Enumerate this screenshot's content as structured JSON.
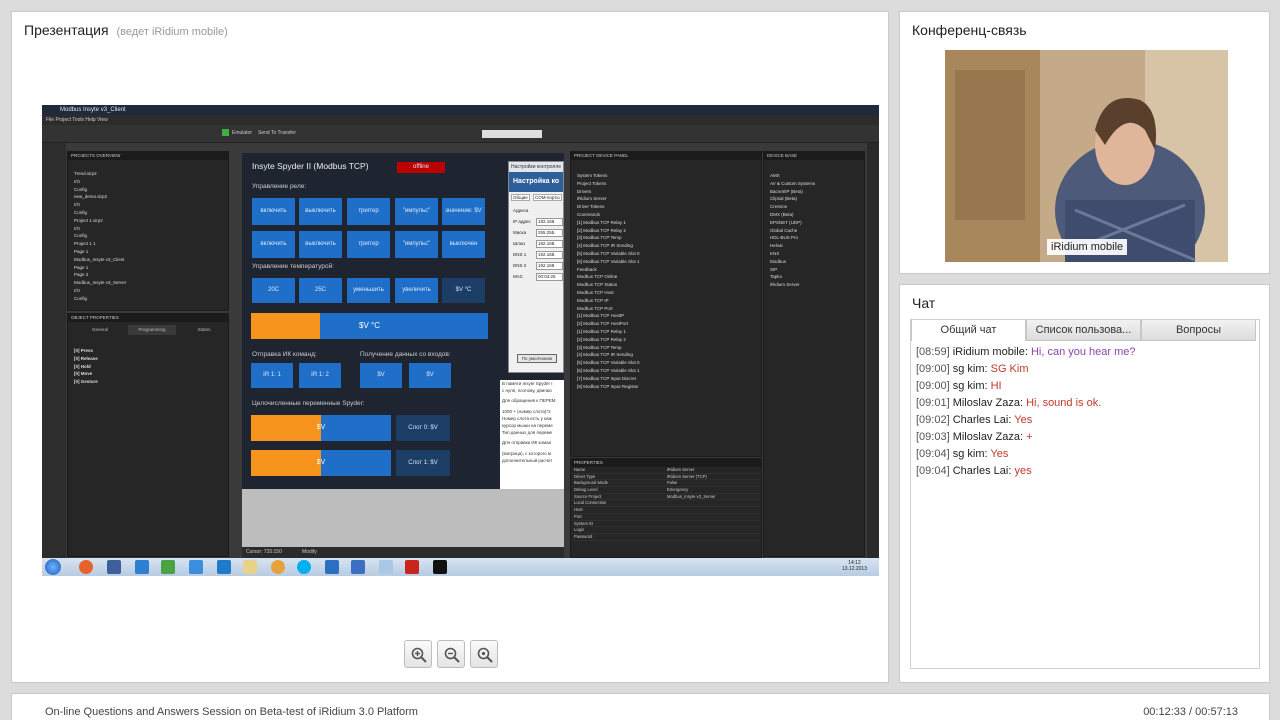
{
  "presentation": {
    "title": "Презентация",
    "subtitle": "(ведет iRidium mobile)"
  },
  "slide": {
    "window_title": "Modbus Insyte v3_Client",
    "menu": "File   Project   Tools   Help   View",
    "toolbar_emulator": "Emulator",
    "toolbar_send": "Send To Transfer",
    "projects_header": "PROJECTS OVERVIEW",
    "project_tree": [
      "Trend.sirp2",
      "I/O",
      "Config",
      "new_demo.sirp2",
      "I/O",
      "Config",
      "Project 1.sirp2",
      "I/O",
      "Config",
      "Project 1 1",
      "Page 1",
      "Modbus_Insyte v3_Client",
      "Page 1",
      "Page 2",
      "Modbus_Insyte v3_Server",
      "I/O",
      "Config"
    ],
    "object_props_header": "OBJECT PROPERTIES",
    "object_tabs": [
      "General",
      "Programming",
      "States"
    ],
    "object_events": [
      "[0] Press",
      "[0] Release",
      "[0] Hold",
      "[0] Move",
      "[0] Gesture"
    ],
    "device_panel_header": "PROJECT DEVICE PANEL",
    "device_tree": [
      "System Tokens",
      "Project Tokens",
      "Drivers",
      "iRidium Server",
      "Driver Tokens",
      "Commands",
      "[1] Modbus TCP Relay 1",
      "[2] Modbus TCP Relay 2",
      "[3] Modbus TCP Temp",
      "[4] Modbus TCP IR Sending",
      "[5] Modbus TCP Variable Slot 0",
      "[6] Modbus TCP Variable Slot 1",
      "Feedback",
      "Modbus TCP Online",
      "Modbus TCP Status",
      "Modbus TCP Host",
      "Modbus TCP IP",
      "Modbus TCP Port",
      "[1] Modbus TCP HostIP",
      "[2] Modbus TCP HostPort",
      "[1] Modbus TCP Relay 1",
      "[2] Modbus TCP Relay 2",
      "[3] Modbus TCP Temp",
      "[4] Modbus TCP IR Sending",
      "[5] Modbus TCP Variable Slot 0",
      "[6] Modbus TCP Variable Slot 1",
      "[7] Modbus TCP Input Discret",
      "[8] Modbus TCP Input Register"
    ],
    "device_base_header": "DEVICE BASE",
    "device_base_tree": [
      "AMX",
      "AV & Custom Systems",
      "Bacnet/IP (Beta)",
      "Clipsal (Beta)",
      "Crestron",
      "DMX (Beta)",
      "EPSNET (UDP)",
      "Global Cache",
      "HDL-BUS Pro",
      "Helvar",
      "KNX",
      "Modbus",
      "SIP",
      "Tapko",
      "iRidium Server"
    ],
    "properties_header": "PROPERTIES",
    "properties": [
      {
        "k": "Name",
        "v": "iRidium Server"
      },
      {
        "k": "Driver Type",
        "v": "iRidium Server (TCP)"
      },
      {
        "k": "Background Mode",
        "v": "False"
      },
      {
        "k": "Debug Level",
        "v": "Emergency"
      },
      {
        "k": "Source Project",
        "v": "Modbus_Insyte v3_Server"
      },
      {
        "k": "Local Connection",
        "v": ""
      },
      {
        "k": "Host",
        "v": ""
      },
      {
        "k": "Port",
        "v": ""
      },
      {
        "k": "System ID",
        "v": ""
      },
      {
        "k": "Login",
        "v": ""
      },
      {
        "k": "Password",
        "v": ""
      }
    ],
    "canvas_title": "Insyte Spyder II (Modbus TCP)",
    "status_badge": "offline",
    "relay_label": "Управление реле:",
    "relay_row1": [
      "включить",
      "выключить",
      "триггер",
      "\"импульс\"",
      "значение: $V"
    ],
    "relay_row2": [
      "включить",
      "выключить",
      "триггер",
      "\"импульс\"",
      "выключен"
    ],
    "temp_label": "Управление температурой:",
    "temp_buttons": [
      "20С",
      "25С",
      "уменьшить",
      "увеличить",
      "$V °C"
    ],
    "temp_bar_text": "$V °C",
    "ir_label": "Отправка ИК команд:",
    "ir_buttons": [
      "IR 1: 1",
      "IR 1: 2"
    ],
    "receive_label": "Получение данных со входов:",
    "receive_buttons": [
      "$V",
      "$V"
    ],
    "vars_label": "Целочисленные переменные Spyder:",
    "slot_bar_text": "$V",
    "slots": [
      "Слот 0: $V",
      "Слот 1: $V"
    ],
    "dialog_title": "Настройка ко",
    "dialog_tabs": [
      "Общие",
      "COM-порты"
    ],
    "dialog_fields": [
      "Адреса",
      "IP адрес",
      "Маска",
      "Шлюз",
      "DNS 1",
      "DNS 2",
      "MAC"
    ],
    "dialog_values": [
      "192.168.",
      "255.255.",
      "192.168.",
      "192.168.",
      "192.168.",
      "00:04:25"
    ],
    "dialog_button": "По умолчанию",
    "notes": [
      "В памяти Insyte Spyder I",
      "с нуля, поэтому, двигаю",
      "Для обращения к ПЕРЕМ",
      "1000 + (номер слота)*2",
      "Номер слота есть у каж",
      "курсор мыши на переме",
      "Тип данных для переме",
      "Для отправки ИК коман",
      "(матрица), с которого м",
      "дополнительный расчет"
    ],
    "status_bar": "Cursor: 735:150",
    "status_mode": "Modify",
    "clock_time": "14:12",
    "clock_date": "13.12.2013"
  },
  "zoom": {
    "zoom_in_icon": "zoom-in-icon",
    "zoom_out_icon": "zoom-out-icon",
    "zoom_fit_icon": "zoom-fit-icon"
  },
  "conference": {
    "title": "Конференц-связь",
    "video_label": "iRidium mobile"
  },
  "chat": {
    "title": "Чат",
    "tabs": [
      "Общий чат",
      "Список пользова...",
      "Вопросы"
    ],
    "messages": [
      {
        "time": "[08:59]",
        "author": "iRidium mobile:",
        "text": "Hi, can you hear me?",
        "host": true
      },
      {
        "time": "[09:00]",
        "author": "sg kim:",
        "text": "SG Kim",
        "host": false
      },
      {
        "time": "[09:00]",
        "author": "sg kim:",
        "text": "HI",
        "host": false
      },
      {
        "time": "[09:01]",
        "author": "Miloslav Zaza:",
        "text": "Hi, sound is ok.",
        "host": false
      },
      {
        "time": "[09:02]",
        "author": "Charles Lai:",
        "text": "Yes",
        "host": false
      },
      {
        "time": "[09:03]",
        "author": "Miloslav Zaza:",
        "text": "+",
        "host": false
      },
      {
        "time": "[09:04]",
        "author": "sg kim:",
        "text": "Yes",
        "host": false
      },
      {
        "time": "[09:04]",
        "author": "Charles Lai:",
        "text": "yes",
        "host": false
      }
    ]
  },
  "footer": {
    "session_title": "On-line Questions and Answers Session on Beta-test of iRidium 3.0 Platform",
    "time": "00:12:33 / 00:57:13"
  },
  "colors": {
    "accent_blue": "#1f6fc9",
    "progress_orange": "#f7941d",
    "chat_text_red": "#c0392b",
    "host_text_purple": "#8e44ad"
  },
  "levels": {
    "temp_bar_fill": 0.5,
    "slot_bar_fill": 0.5
  }
}
